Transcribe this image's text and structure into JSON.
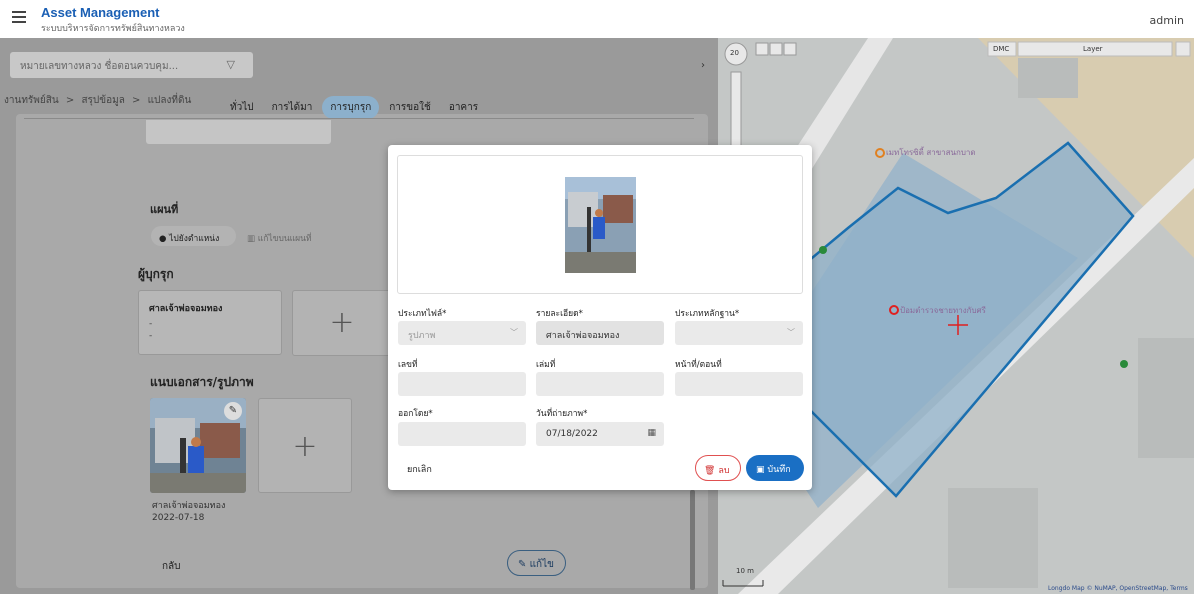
{
  "app": {
    "title": "Asset Management",
    "subtitle": "ระบบบริหารจัดการทรัพย์สินทางหลวง",
    "user": "admin"
  },
  "search": {
    "placeholder": "หมายเลขทางหลวง ชื่อตอนควบคุม..."
  },
  "breadcrumb": [
    "งานทรัพย์สิน",
    "สรุปข้อมูล",
    "แปลงที่ดิน"
  ],
  "breadcrumb_sep": ">",
  "tabs": [
    "ทั่วไป",
    "การได้มา",
    "การบุกรุก",
    "การขอใช้",
    "อาคาร"
  ],
  "sections": {
    "map": "แผนที่",
    "encroacher": "ผู้บุกรุก",
    "attachments": "แนบเอกสาร/รูปภาพ"
  },
  "map_chip": {
    "goto": "ไปยังตำแหน่ง",
    "edit": "แก้ไขบนแผนที่"
  },
  "encroacher_card": {
    "name": "ศาลเจ้าพ่อจอมทอง",
    "line1": "-",
    "line2": "-"
  },
  "photo_card": {
    "caption": "ศาลเจ้าพ่อจอมทอง",
    "date": "2022-07-18"
  },
  "footer": {
    "back": "กลับ",
    "edit": "แก้ไข"
  },
  "dialog": {
    "file_type": {
      "label": "ประเภทไฟล์*",
      "value": "รูปภาพ"
    },
    "detail": {
      "label": "รายละเอียด*",
      "value": "ศาลเจ้าพ่อจอมทอง"
    },
    "evidence_type": {
      "label": "ประเภทหลักฐาน*",
      "value": ""
    },
    "number": {
      "label": "เลขที่",
      "value": ""
    },
    "book": {
      "label": "เล่มที่",
      "value": ""
    },
    "page": {
      "label": "หน้าที่/ตอนที่",
      "value": ""
    },
    "issued_by": {
      "label": "ออกโดย*",
      "value": ""
    },
    "photo_date": {
      "label": "วันที่ถ่ายภาพ*",
      "value": "07/18/2022"
    },
    "cancel": "ยกเลิก",
    "delete": "ลบ",
    "save": "บันทึก"
  },
  "map": {
    "layer_label": "Layer",
    "dmc": "DMC",
    "zoom": "20",
    "scale": "10 m",
    "poi1": "เมทโทรซิตี้ สาขาสนกบาด",
    "poi2": "ป้อมตำรวจชายทางกับศรี",
    "attribution": "Longdo Map © NuMAP, OpenStreetMap, Terms"
  }
}
